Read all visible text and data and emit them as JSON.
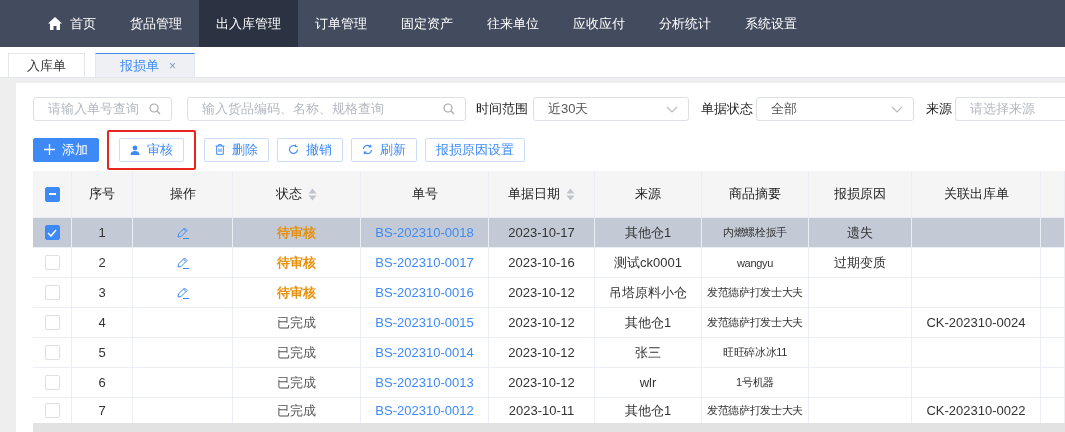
{
  "nav": {
    "items": [
      {
        "label": "首页",
        "kind": "home",
        "selected": false
      },
      {
        "label": "货品管理",
        "selected": false
      },
      {
        "label": "出入库管理",
        "selected": true
      },
      {
        "label": "订单管理",
        "selected": false
      },
      {
        "label": "固定资产",
        "selected": false
      },
      {
        "label": "往来单位",
        "selected": false
      },
      {
        "label": "应收应付",
        "selected": false
      },
      {
        "label": "分析统计",
        "selected": false
      },
      {
        "label": "系统设置",
        "selected": false
      }
    ]
  },
  "tabs": [
    {
      "label": "入库单",
      "selected": false,
      "closable": false
    },
    {
      "label": "报损单",
      "selected": true,
      "closable": true,
      "close": "×"
    }
  ],
  "filters": {
    "order_search": {
      "placeholder": "请输入单号查询"
    },
    "goods_search": {
      "placeholder": "输入货品编码、名称、规格查询"
    },
    "time_range": {
      "label": "时间范围",
      "value": "近30天"
    },
    "doc_status": {
      "label": "单据状态",
      "value": "全部"
    },
    "source": {
      "label": "来源",
      "placeholder": "请选择来源"
    }
  },
  "toolbar": [
    {
      "label": "添加",
      "kind": "add",
      "primary": true,
      "highlighted": false
    },
    {
      "label": "审核",
      "kind": "audit",
      "primary": false,
      "highlighted": true
    },
    {
      "label": "删除",
      "kind": "delete",
      "primary": false,
      "highlighted": false
    },
    {
      "label": "撤销",
      "kind": "undo",
      "primary": false,
      "highlighted": false
    },
    {
      "label": "刷新",
      "kind": "refresh",
      "primary": false,
      "highlighted": false
    },
    {
      "label": "报损原因设置",
      "kind": "plain",
      "primary": false,
      "highlighted": false
    }
  ],
  "table": {
    "select_all_indeterminate": true,
    "columns": [
      {
        "label": "序号",
        "sortable": false
      },
      {
        "label": "操作",
        "sortable": false
      },
      {
        "label": "状态",
        "sortable": true
      },
      {
        "label": "单号",
        "sortable": false
      },
      {
        "label": "单据日期",
        "sortable": true
      },
      {
        "label": "来源",
        "sortable": false
      },
      {
        "label": "商品摘要",
        "sortable": false
      },
      {
        "label": "报损原因",
        "sortable": false
      },
      {
        "label": "关联出库单",
        "sortable": false
      }
    ],
    "rows": [
      {
        "checked": true,
        "selected": true,
        "no": "1",
        "editable": true,
        "status": "待审核",
        "pending": true,
        "order": "BS-202310-0018",
        "date": "2023-10-17",
        "source": "其他仓1",
        "summary": "内燃螺栓扳手",
        "reason": "遗失",
        "outbound": ""
      },
      {
        "checked": false,
        "selected": false,
        "no": "2",
        "editable": true,
        "status": "待审核",
        "pending": true,
        "order": "BS-202310-0017",
        "date": "2023-10-16",
        "source": "测试ck0001",
        "summary": "wangyu",
        "reason": "过期变质",
        "outbound": ""
      },
      {
        "checked": false,
        "selected": false,
        "no": "3",
        "editable": true,
        "status": "待审核",
        "pending": true,
        "order": "BS-202310-0016",
        "date": "2023-10-12",
        "source": "吊塔原料小仓",
        "summary": "发范德萨打发士大夫",
        "reason": "",
        "outbound": ""
      },
      {
        "checked": false,
        "selected": false,
        "no": "4",
        "editable": false,
        "status": "已完成",
        "pending": false,
        "order": "BS-202310-0015",
        "date": "2023-10-12",
        "source": "其他仓1",
        "summary": "发范德萨打发士大夫",
        "reason": "",
        "outbound": "CK-202310-0024"
      },
      {
        "checked": false,
        "selected": false,
        "no": "5",
        "editable": false,
        "status": "已完成",
        "pending": false,
        "order": "BS-202310-0014",
        "date": "2023-10-12",
        "source": "张三",
        "summary": "旺旺碎冰冰11",
        "reason": "",
        "outbound": ""
      },
      {
        "checked": false,
        "selected": false,
        "no": "6",
        "editable": false,
        "status": "已完成",
        "pending": false,
        "order": "BS-202310-0013",
        "date": "2023-10-12",
        "source": "wlr",
        "summary": "1号机器",
        "reason": "",
        "outbound": ""
      },
      {
        "checked": false,
        "selected": false,
        "no": "7",
        "editable": false,
        "status": "已完成",
        "pending": false,
        "order": "BS-202310-0012",
        "date": "2023-10-11",
        "source": "其他仓1",
        "summary": "发范德萨打发士大夫",
        "reason": "",
        "outbound": "CK-202310-0022"
      }
    ]
  }
}
